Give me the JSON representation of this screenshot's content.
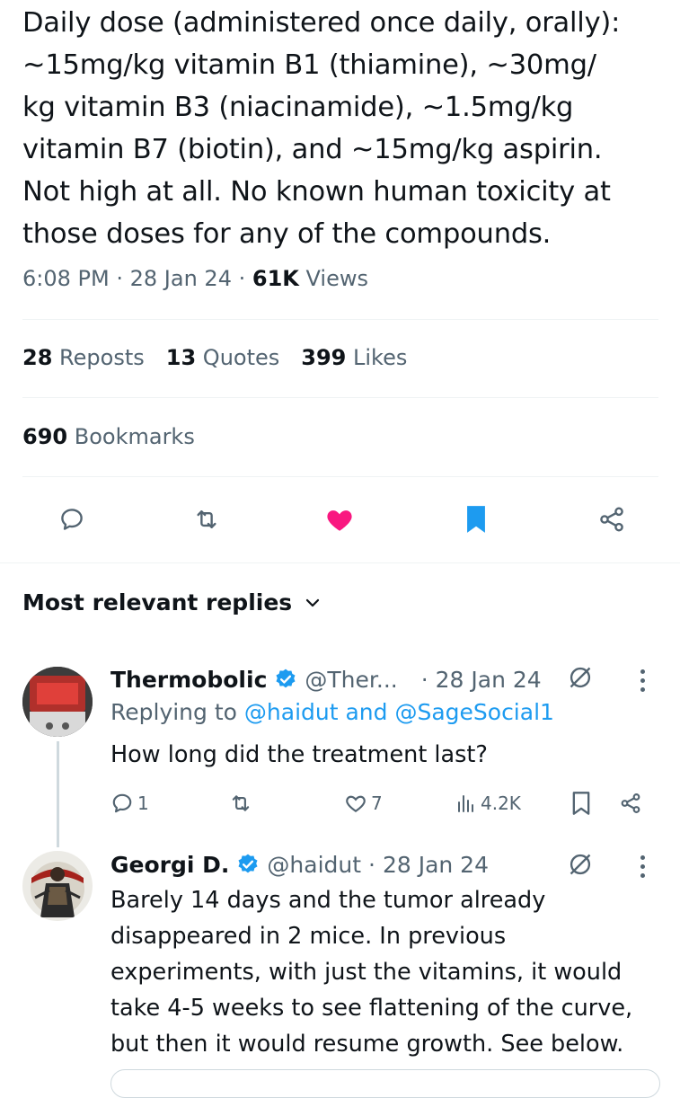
{
  "tweet": {
    "text": "Daily dose (administered once daily, orally):\n~15mg/kg vitamin B1 (thiamine), ~30mg/\nkg vitamin B3 (niacinamide), ~1.5mg/kg\nvitamin B7 (biotin), and ~15mg/kg aspirin.\nNot high at all. No known human toxicity at\nthose doses for any of the compounds.",
    "time": "6:08 PM",
    "date": "28 Jan 24",
    "views_count": "61K",
    "views_label": "Views",
    "sep": "·"
  },
  "stats": {
    "reposts_count": "28",
    "reposts_label": "Reposts",
    "quotes_count": "13",
    "quotes_label": "Quotes",
    "likes_count": "399",
    "likes_label": "Likes",
    "bookmarks_count": "690",
    "bookmarks_label": "Bookmarks"
  },
  "actions": {
    "icons": [
      "reply-icon",
      "repost-icon",
      "like-icon",
      "bookmark-icon",
      "share-icon"
    ],
    "like_color": "#f91880",
    "bookmark_color": "#1d9bf0"
  },
  "replies_section": {
    "title": "Most relevant replies"
  },
  "replies": [
    {
      "name": "Thermobolic",
      "handle": "@Ther...",
      "date": "· 28 Jan 24",
      "replying_prefix": "Replying to",
      "replying_to": "@haidut and @SageSocial1",
      "text": "How long did the treatment last?",
      "reply_count": "1",
      "like_count": "7",
      "views": "4.2K"
    },
    {
      "name": "Georgi D.",
      "handle": "@haidut",
      "date": "· 28 Jan 24",
      "text": "Barely 14 days and the tumor already\ndisappeared in 2 mice. In previous\nexperiments, with just the vitamins, it would\ntake 4-5 weeks to see flattening of the curve,\nbut then it would resume growth. See below."
    }
  ],
  "colors": {
    "accent": "#1d9bf0",
    "muted": "#536471",
    "text": "#0f1419",
    "verified": "#1d9bf0"
  }
}
